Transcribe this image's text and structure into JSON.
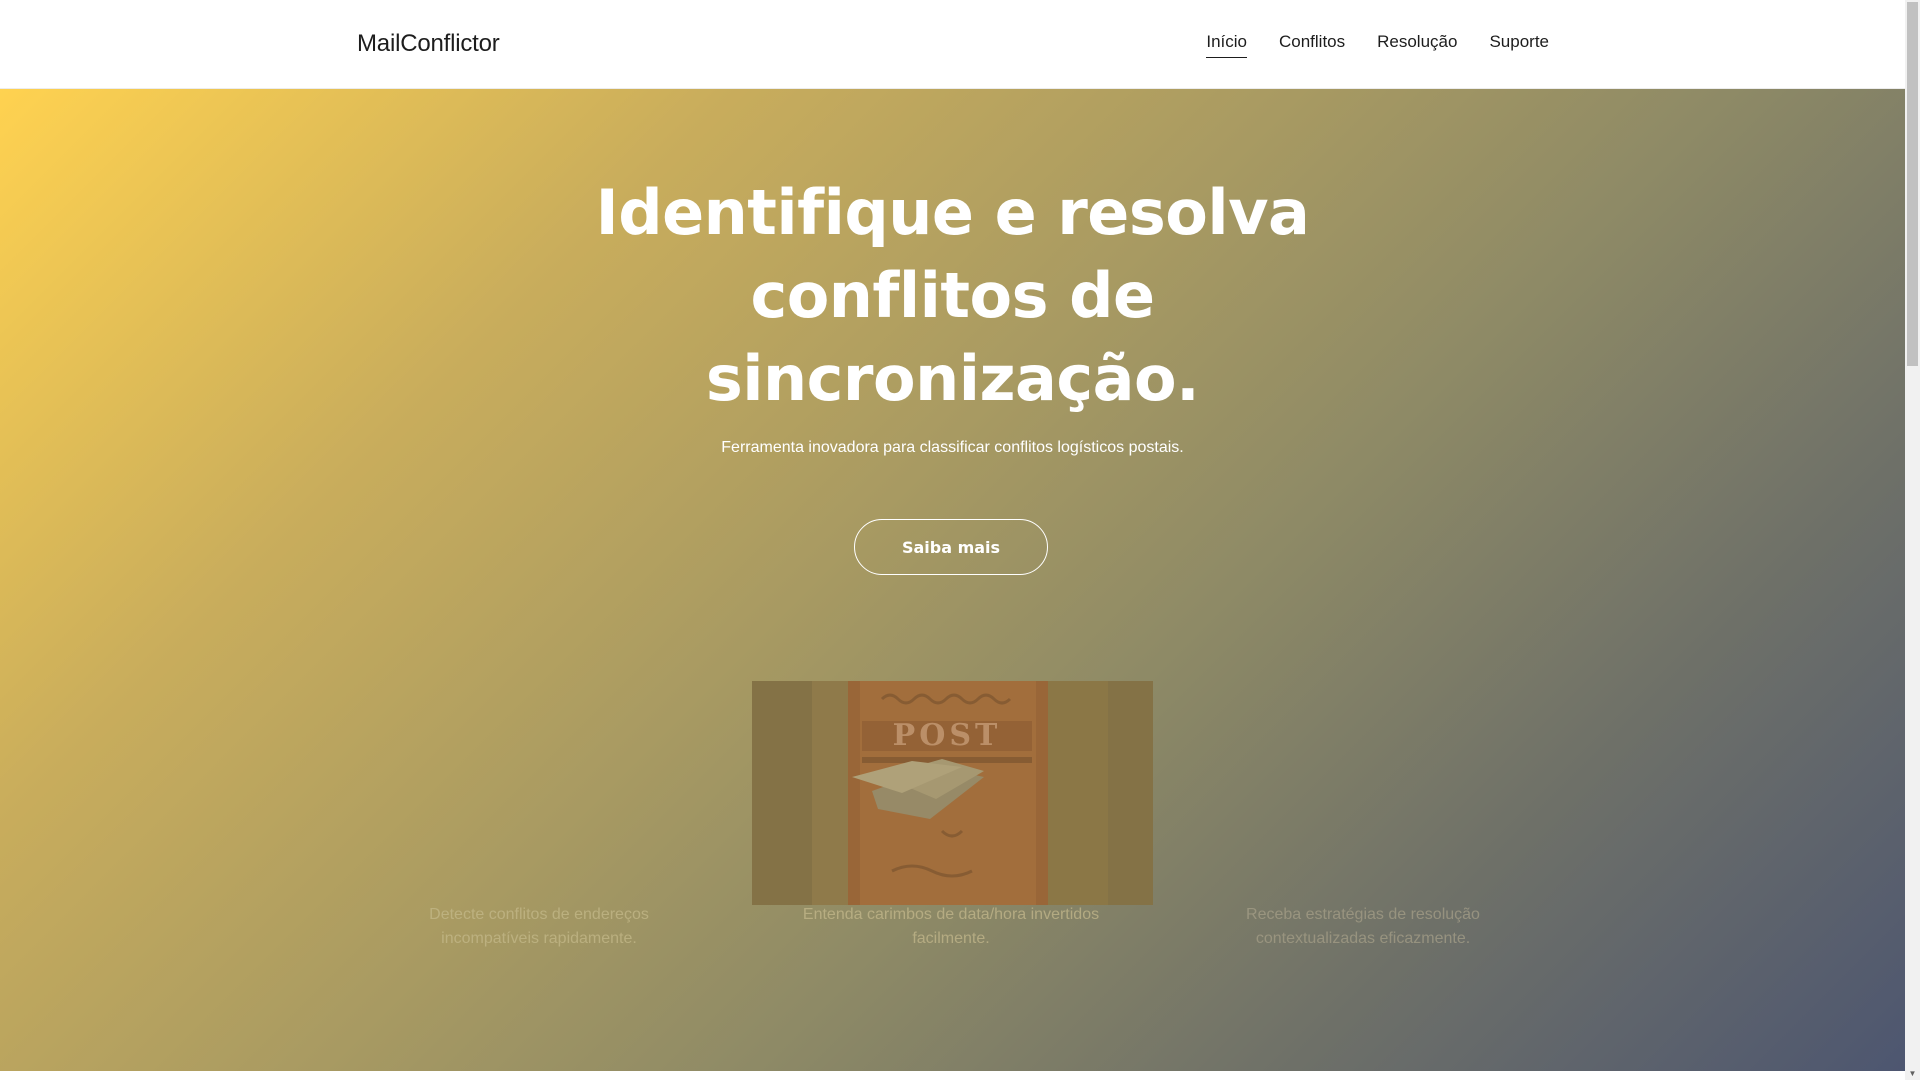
{
  "header": {
    "brand": "MailConflictor",
    "nav": [
      {
        "label": "Início",
        "active": true
      },
      {
        "label": "Conflitos",
        "active": false
      },
      {
        "label": "Resolução",
        "active": false
      },
      {
        "label": "Suporte",
        "active": false
      }
    ]
  },
  "hero": {
    "title_lines": [
      "Identifique e resolva",
      "conflitos de",
      "sincronização."
    ],
    "subtitle": "Ferramenta inovadora para classificar conflitos logísticos postais.",
    "cta_label": "Saiba mais"
  },
  "features": [
    {
      "text": "Detecte conflitos de endereços incompatíveis rapidamente."
    },
    {
      "text": "Entenda carimbos de data/hora invertidos facilmente."
    },
    {
      "text": "Receba estratégias de resolução contextualizadas eficazmente."
    }
  ],
  "image": {
    "sign_text": "POST",
    "icon": "mailbox-image"
  },
  "colors": {
    "gradient_start": "#ffd250",
    "gradient_end": "#4d5670",
    "text_dark": "#1d1d1d"
  }
}
